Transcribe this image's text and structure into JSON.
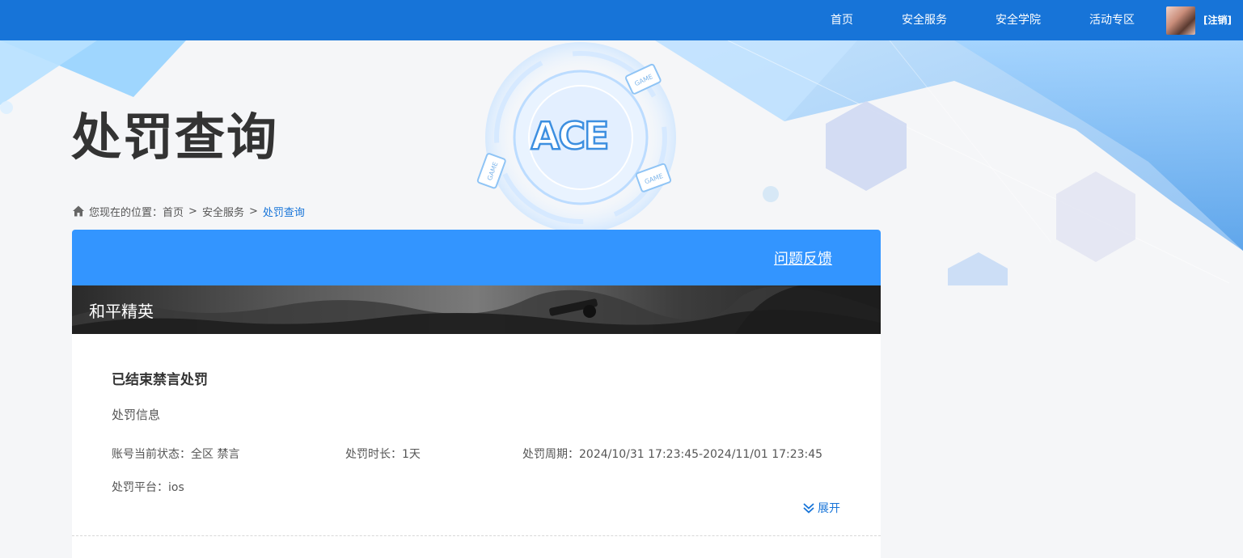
{
  "nav": {
    "items": [
      "首页",
      "安全服务",
      "安全学院",
      "活动专区"
    ],
    "logout": "[注销]"
  },
  "page": {
    "title": "处罚查询",
    "logo_text": "ACE"
  },
  "breadcrumb": {
    "prefix": "您现在的位置：",
    "items": [
      "首页",
      "安全服务",
      "处罚查询"
    ],
    "separator": ">"
  },
  "card": {
    "feedback": "问题反馈",
    "game_name": "和平精英",
    "status_title": "已结束禁言处罚",
    "section_label": "处罚信息",
    "account_status": "账号当前状态：全区 禁言",
    "duration": "处罚时长：1天",
    "period": "处罚周期：2024/10/31 17:23:45-2024/11/01 17:23:45",
    "platform": "处罚平台：ios",
    "expand": "展开"
  },
  "decor": {
    "game_tag": "GAME"
  },
  "colors": {
    "nav_blue": "#1774d8",
    "card_blue": "#3395ff",
    "link_blue": "#1774d8"
  }
}
